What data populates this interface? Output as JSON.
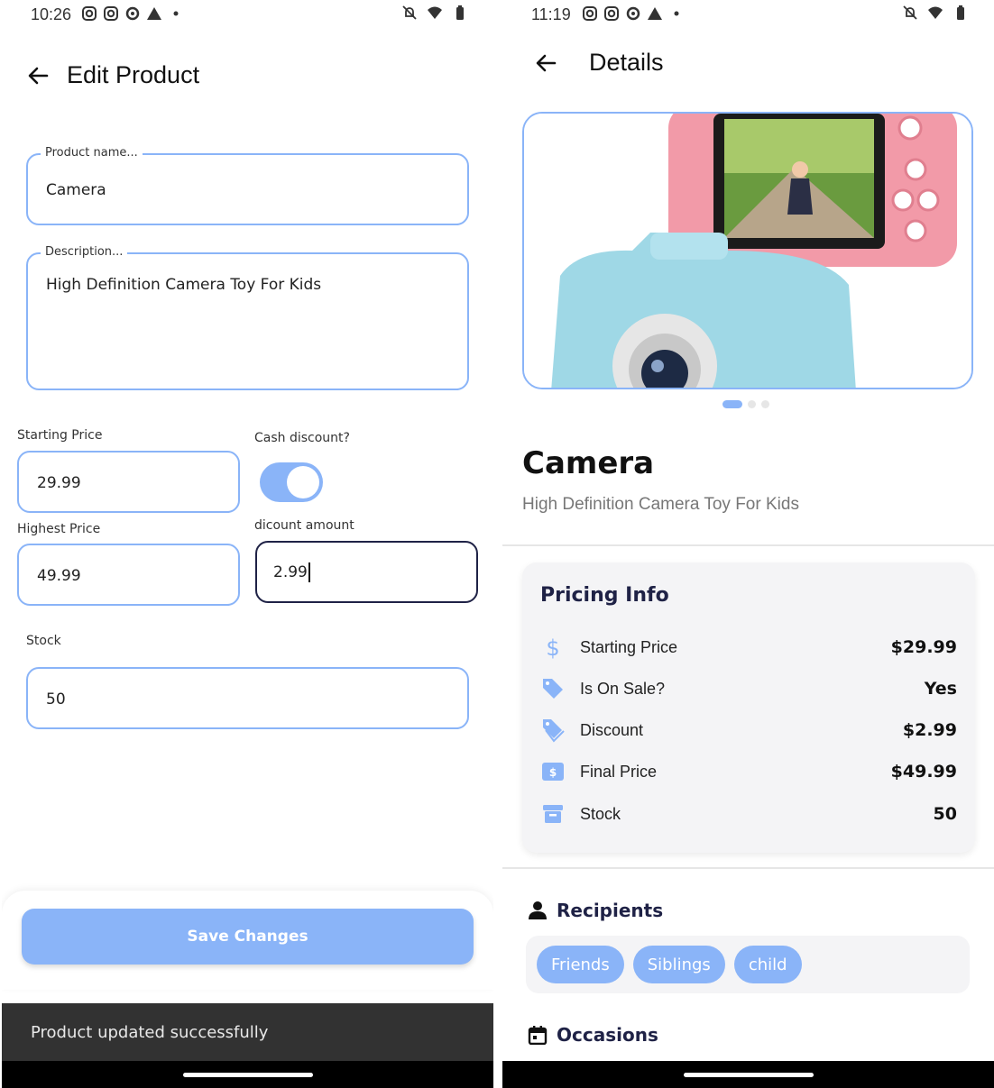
{
  "colors": {
    "accent": "#8ab4f8",
    "snackbar": "#323232",
    "heading": "#1f2246"
  },
  "left_screen": {
    "status": {
      "time": "10:26"
    },
    "appbar": {
      "title": "Edit Product"
    },
    "form": {
      "product_name": {
        "label": "Product name...",
        "value": "Camera"
      },
      "description": {
        "label": "Description...",
        "value": "High Definition Camera Toy For Kids"
      },
      "starting_price": {
        "label": "Starting Price",
        "value": "29.99"
      },
      "cash_discount": {
        "label": "Cash discount?",
        "enabled": true
      },
      "highest_price": {
        "label": "Highest Price",
        "value": "49.99"
      },
      "discount_amount": {
        "label": "dicount amount",
        "value": "2.99"
      },
      "stock": {
        "label": "Stock",
        "value": "50"
      }
    },
    "save_label": "Save Changes",
    "snackbar": "Product updated successfully"
  },
  "right_screen": {
    "status": {
      "time": "11:19"
    },
    "appbar": {
      "title": "Details"
    },
    "carousel": {
      "count": 3,
      "active": 0
    },
    "product": {
      "name": "Camera",
      "description": "High Definition Camera Toy For Kids"
    },
    "pricing": {
      "title": "Pricing Info",
      "rows": [
        {
          "icon": "dollar-icon",
          "label": "Starting Price",
          "value": "$29.99"
        },
        {
          "icon": "tag-icon",
          "label": "Is On Sale?",
          "value": "Yes"
        },
        {
          "icon": "tags-icon",
          "label": "Discount",
          "value": "$2.99"
        },
        {
          "icon": "money-bill-icon",
          "label": "Final Price",
          "value": "$49.99"
        },
        {
          "icon": "archive-box-icon",
          "label": "Stock",
          "value": "50"
        }
      ]
    },
    "recipients": {
      "title": "Recipients",
      "chips": [
        "Friends",
        "Siblings",
        "child"
      ]
    },
    "occasions": {
      "title": "Occasions"
    }
  }
}
